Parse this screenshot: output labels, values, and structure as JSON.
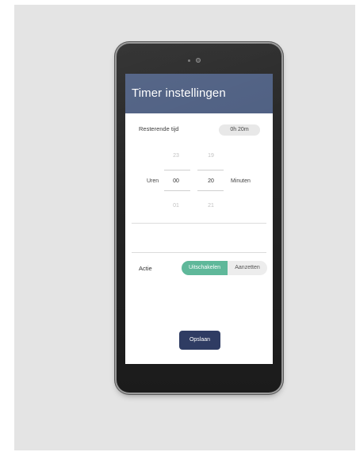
{
  "screen": {
    "title": "Timer instellingen"
  },
  "remaining": {
    "label": "Resterende tijd",
    "value": "0h 20m"
  },
  "picker": {
    "hours": {
      "prev": "23",
      "current": "00",
      "next": "01",
      "label": "Uren"
    },
    "minutes": {
      "prev": "19",
      "current": "20",
      "next": "21",
      "label": "Minuten"
    }
  },
  "action": {
    "label": "Actie",
    "options": [
      "Uitschakelen",
      "Aanzetten"
    ],
    "selected": "Uitschakelen"
  },
  "save_label": "Opslaan",
  "colors": {
    "header": "#4e5f82",
    "toggle_active": "#5fb89a",
    "save_button": "#2f3c63"
  }
}
